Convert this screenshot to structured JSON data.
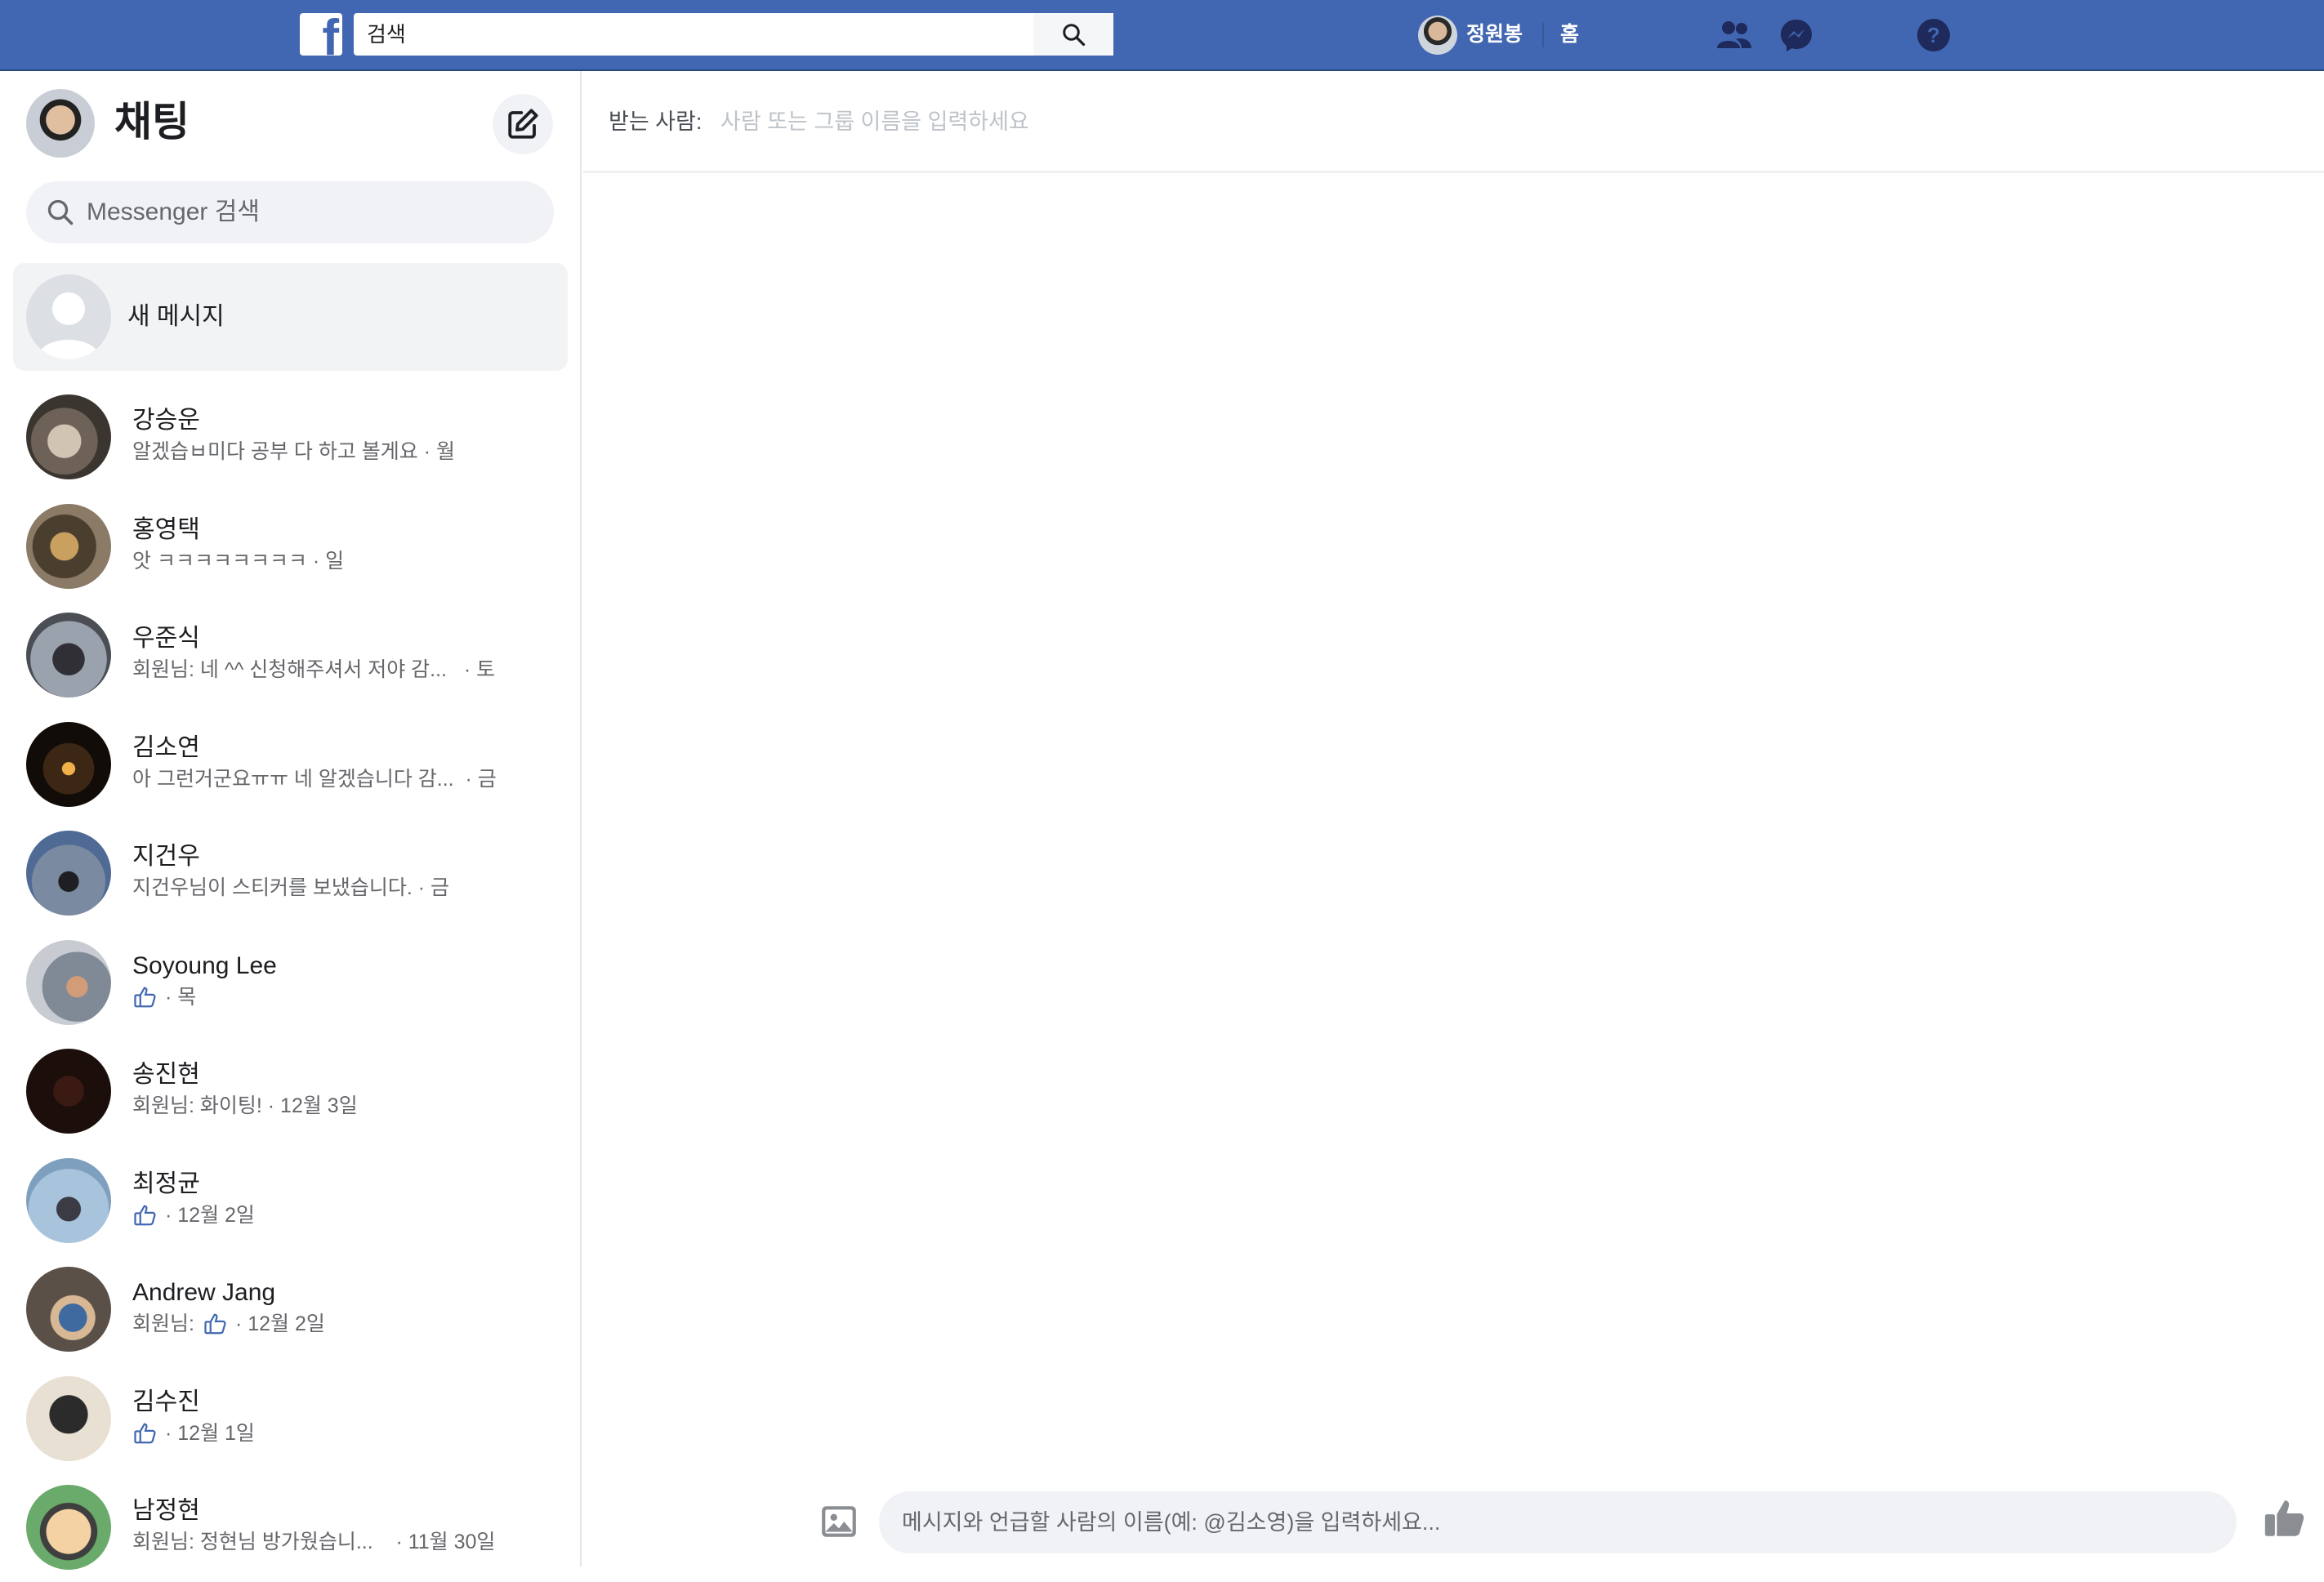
{
  "topbar": {
    "logo_icon": "facebook-f-icon",
    "search_placeholder": "검색",
    "user_name": "정원봉",
    "home_label": "홈",
    "icons": [
      "friends-icon",
      "messenger-icon",
      "help-icon"
    ],
    "bg_color": "#4267b2"
  },
  "sidebar": {
    "title": "채팅",
    "compose_icon": "compose-icon",
    "search_placeholder": "Messenger 검색",
    "new_message_label": "새 메시지",
    "conversations": [
      {
        "name": "강승운",
        "snippet": "알겠습ㅂ미다 공부 다 하고 볼게요 · 월",
        "like": false
      },
      {
        "name": "홍영택",
        "snippet": "앗 ㅋㅋㅋㅋㅋㅋㅋㅋ · 일",
        "like": false
      },
      {
        "name": "우준식",
        "snippet": "회원님: 네 ^^ 신청해주셔서 저야 감...   · 토",
        "like": false
      },
      {
        "name": "김소연",
        "snippet": "아 그런거군요ㅠㅠ 네 알겠습니다 감...  · 금",
        "like": false
      },
      {
        "name": "지건우",
        "snippet": "지건우님이 스티커를 보냈습니다. · 금",
        "like": false
      },
      {
        "name": "Soyoung Lee",
        "snippet_prefix": "",
        "snippet": "· 목",
        "like": true
      },
      {
        "name": "송진현",
        "snippet": "회원님: 화이팅! · 12월 3일",
        "like": false
      },
      {
        "name": "최정균",
        "snippet_prefix": "",
        "snippet": "· 12월 2일",
        "like": true
      },
      {
        "name": "Andrew Jang",
        "snippet_prefix": "회원님:",
        "snippet": "· 12월 2일",
        "like": true
      },
      {
        "name": "김수진",
        "snippet_prefix": "",
        "snippet": "· 12월 1일",
        "like": true
      },
      {
        "name": "남정현",
        "snippet": "회원님: 정현님 방가웠습니...    · 11월 30일",
        "like": false
      }
    ]
  },
  "main": {
    "to_label": "받는 사람:",
    "to_placeholder": "사람 또는 그룹 이름을 입력하세요",
    "message_placeholder": "메시지와 언급할 사람의 이름(예: @김소영)을 입력하세요...",
    "attach_icon": "image-icon",
    "like_icon": "thumbs-up-icon"
  }
}
